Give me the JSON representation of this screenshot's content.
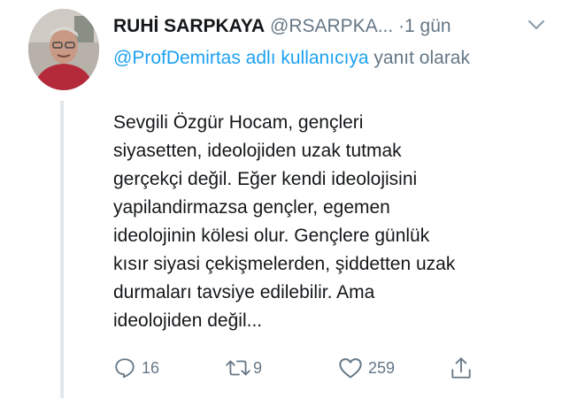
{
  "tweet": {
    "author_name": "RUHİ SARPKAYA",
    "handle": "@RSARPKA...",
    "separator": "·",
    "time": "1 gün",
    "reply_mention": "@ProfDemirtas adlı kullanıcıya",
    "reply_suffix": " yanıt olarak",
    "text": "Sevgili Özgür Hocam, gençleri\nsiyasetten, ideolojiden uzak tutmak\ngerçekçi değil. Eğer kendi ideolojisini\nyapilandirmazsa  gençler, egemen\nideolojinin kölesi olur. Gençlere günlük\nkısır siyasi çekişmelerden, şiddetten uzak\ndurmaları tavsiye edilebilir. Ama\nideolojiden değil..."
  },
  "actions": {
    "reply_count": "16",
    "retweet_count": "9",
    "like_count": "259"
  },
  "icons": {
    "menu": "chevron-down-icon",
    "reply": "reply-icon",
    "retweet": "retweet-icon",
    "like": "heart-icon",
    "share": "share-icon"
  },
  "colors": {
    "link": "#1da1f2",
    "secondary": "#657786",
    "thread_line": "#e1e8ed"
  }
}
